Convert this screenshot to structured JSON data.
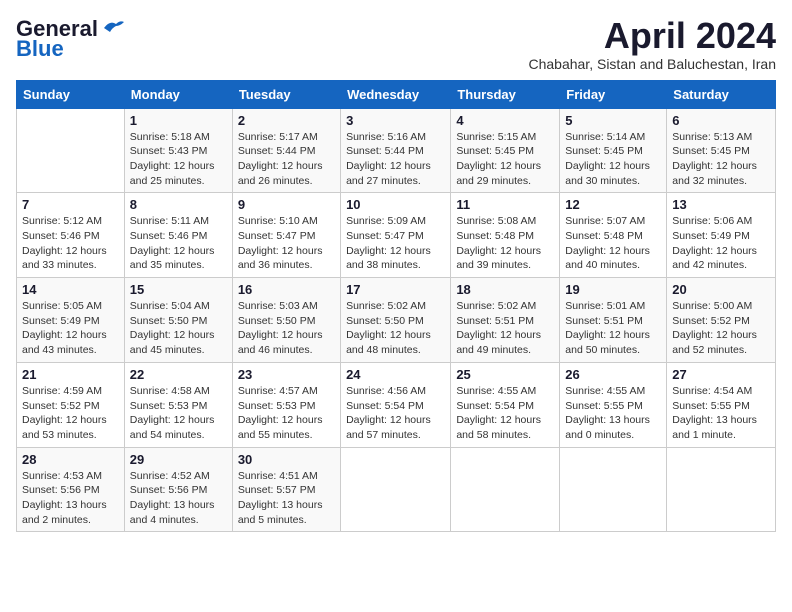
{
  "logo": {
    "line1": "General",
    "line2": "Blue"
  },
  "title": "April 2024",
  "subtitle": "Chabahar, Sistan and Baluchestan, Iran",
  "days_of_week": [
    "Sunday",
    "Monday",
    "Tuesday",
    "Wednesday",
    "Thursday",
    "Friday",
    "Saturday"
  ],
  "weeks": [
    [
      {
        "day": "",
        "info": ""
      },
      {
        "day": "1",
        "info": "Sunrise: 5:18 AM\nSunset: 5:43 PM\nDaylight: 12 hours\nand 25 minutes."
      },
      {
        "day": "2",
        "info": "Sunrise: 5:17 AM\nSunset: 5:44 PM\nDaylight: 12 hours\nand 26 minutes."
      },
      {
        "day": "3",
        "info": "Sunrise: 5:16 AM\nSunset: 5:44 PM\nDaylight: 12 hours\nand 27 minutes."
      },
      {
        "day": "4",
        "info": "Sunrise: 5:15 AM\nSunset: 5:45 PM\nDaylight: 12 hours\nand 29 minutes."
      },
      {
        "day": "5",
        "info": "Sunrise: 5:14 AM\nSunset: 5:45 PM\nDaylight: 12 hours\nand 30 minutes."
      },
      {
        "day": "6",
        "info": "Sunrise: 5:13 AM\nSunset: 5:45 PM\nDaylight: 12 hours\nand 32 minutes."
      }
    ],
    [
      {
        "day": "7",
        "info": "Sunrise: 5:12 AM\nSunset: 5:46 PM\nDaylight: 12 hours\nand 33 minutes."
      },
      {
        "day": "8",
        "info": "Sunrise: 5:11 AM\nSunset: 5:46 PM\nDaylight: 12 hours\nand 35 minutes."
      },
      {
        "day": "9",
        "info": "Sunrise: 5:10 AM\nSunset: 5:47 PM\nDaylight: 12 hours\nand 36 minutes."
      },
      {
        "day": "10",
        "info": "Sunrise: 5:09 AM\nSunset: 5:47 PM\nDaylight: 12 hours\nand 38 minutes."
      },
      {
        "day": "11",
        "info": "Sunrise: 5:08 AM\nSunset: 5:48 PM\nDaylight: 12 hours\nand 39 minutes."
      },
      {
        "day": "12",
        "info": "Sunrise: 5:07 AM\nSunset: 5:48 PM\nDaylight: 12 hours\nand 40 minutes."
      },
      {
        "day": "13",
        "info": "Sunrise: 5:06 AM\nSunset: 5:49 PM\nDaylight: 12 hours\nand 42 minutes."
      }
    ],
    [
      {
        "day": "14",
        "info": "Sunrise: 5:05 AM\nSunset: 5:49 PM\nDaylight: 12 hours\nand 43 minutes."
      },
      {
        "day": "15",
        "info": "Sunrise: 5:04 AM\nSunset: 5:50 PM\nDaylight: 12 hours\nand 45 minutes."
      },
      {
        "day": "16",
        "info": "Sunrise: 5:03 AM\nSunset: 5:50 PM\nDaylight: 12 hours\nand 46 minutes."
      },
      {
        "day": "17",
        "info": "Sunrise: 5:02 AM\nSunset: 5:50 PM\nDaylight: 12 hours\nand 48 minutes."
      },
      {
        "day": "18",
        "info": "Sunrise: 5:02 AM\nSunset: 5:51 PM\nDaylight: 12 hours\nand 49 minutes."
      },
      {
        "day": "19",
        "info": "Sunrise: 5:01 AM\nSunset: 5:51 PM\nDaylight: 12 hours\nand 50 minutes."
      },
      {
        "day": "20",
        "info": "Sunrise: 5:00 AM\nSunset: 5:52 PM\nDaylight: 12 hours\nand 52 minutes."
      }
    ],
    [
      {
        "day": "21",
        "info": "Sunrise: 4:59 AM\nSunset: 5:52 PM\nDaylight: 12 hours\nand 53 minutes."
      },
      {
        "day": "22",
        "info": "Sunrise: 4:58 AM\nSunset: 5:53 PM\nDaylight: 12 hours\nand 54 minutes."
      },
      {
        "day": "23",
        "info": "Sunrise: 4:57 AM\nSunset: 5:53 PM\nDaylight: 12 hours\nand 55 minutes."
      },
      {
        "day": "24",
        "info": "Sunrise: 4:56 AM\nSunset: 5:54 PM\nDaylight: 12 hours\nand 57 minutes."
      },
      {
        "day": "25",
        "info": "Sunrise: 4:55 AM\nSunset: 5:54 PM\nDaylight: 12 hours\nand 58 minutes."
      },
      {
        "day": "26",
        "info": "Sunrise: 4:55 AM\nSunset: 5:55 PM\nDaylight: 13 hours\nand 0 minutes."
      },
      {
        "day": "27",
        "info": "Sunrise: 4:54 AM\nSunset: 5:55 PM\nDaylight: 13 hours\nand 1 minute."
      }
    ],
    [
      {
        "day": "28",
        "info": "Sunrise: 4:53 AM\nSunset: 5:56 PM\nDaylight: 13 hours\nand 2 minutes."
      },
      {
        "day": "29",
        "info": "Sunrise: 4:52 AM\nSunset: 5:56 PM\nDaylight: 13 hours\nand 4 minutes."
      },
      {
        "day": "30",
        "info": "Sunrise: 4:51 AM\nSunset: 5:57 PM\nDaylight: 13 hours\nand 5 minutes."
      },
      {
        "day": "",
        "info": ""
      },
      {
        "day": "",
        "info": ""
      },
      {
        "day": "",
        "info": ""
      },
      {
        "day": "",
        "info": ""
      }
    ]
  ]
}
